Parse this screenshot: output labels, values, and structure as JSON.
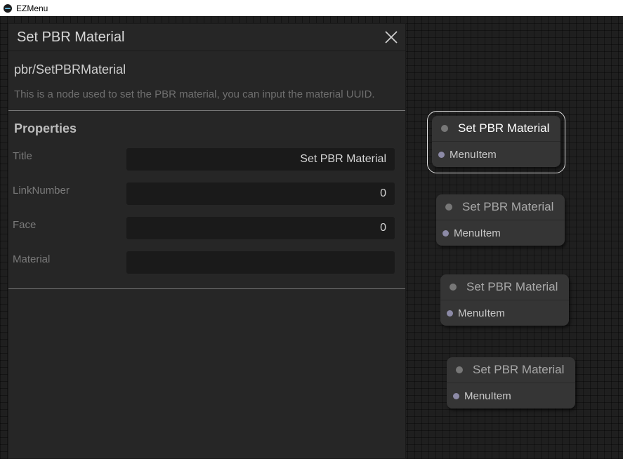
{
  "window": {
    "title": "EZMenu"
  },
  "panel": {
    "title": "Set PBR Material",
    "node_type": "pbr/SetPBRMaterial",
    "description": "This is a node used to set the PBR material, you can input the material UUID.",
    "properties_heading": "Properties",
    "properties": [
      {
        "label": "Title",
        "value": "Set PBR Material"
      },
      {
        "label": "LinkNumber",
        "value": "0"
      },
      {
        "label": "Face",
        "value": "0"
      },
      {
        "label": "Material",
        "value": ""
      }
    ]
  },
  "nodes": [
    {
      "title": "Set PBR Material",
      "output": "MenuItem",
      "selected": true
    },
    {
      "title": "Set PBR Material",
      "output": "MenuItem",
      "selected": false
    },
    {
      "title": "Set PBR Material",
      "output": "MenuItem",
      "selected": false
    },
    {
      "title": "Set PBR Material",
      "output": "MenuItem",
      "selected": false
    }
  ],
  "colors": {
    "canvas": "#1f1f1f",
    "panel": "#262626",
    "node": "#353535",
    "slot": "#8c8aa6"
  },
  "icons": {
    "close": "close-icon",
    "app": "app-icon"
  }
}
